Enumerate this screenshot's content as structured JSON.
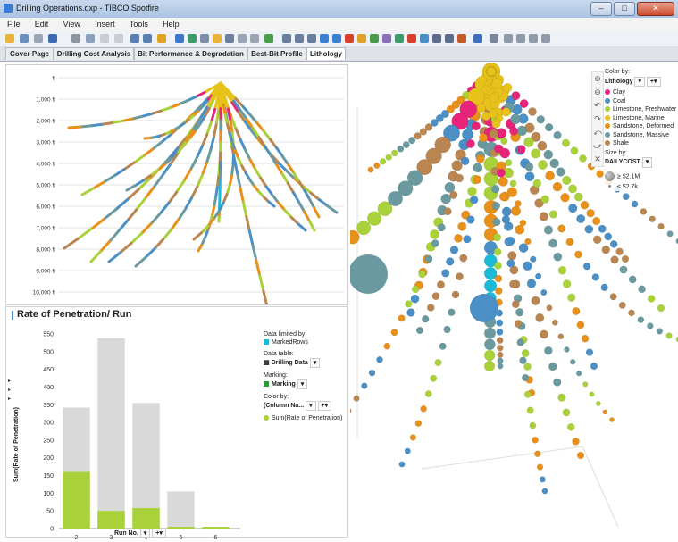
{
  "window": {
    "title": "Drilling Operations.dxp - TIBCO Spotfire",
    "minimize": "–",
    "maximize": "□",
    "close": "✕"
  },
  "menu": [
    "File",
    "Edit",
    "View",
    "Insert",
    "Tools",
    "Help"
  ],
  "tabs": [
    {
      "label": "Cover Page",
      "active": false
    },
    {
      "label": "Drilling Cost Analysis",
      "active": false
    },
    {
      "label": "Bit Performance & Degradation",
      "active": false
    },
    {
      "label": "Best-Bit Profile",
      "active": false
    },
    {
      "label": "Lithology",
      "active": true
    }
  ],
  "depth_axis": {
    "ticks": [
      "ft",
      "1,000 ft",
      "2,000 ft",
      "3,000 ft",
      "4,000 ft",
      "5,000 ft",
      "6,000 ft",
      "7,000 ft",
      "8,000 ft",
      "9,000 ft",
      "10,000 ft"
    ]
  },
  "lithology_legend": {
    "color_by_label": "Color by:",
    "color_by_value": "Lithology",
    "items": [
      {
        "label": "Clay",
        "color": "#e8247a"
      },
      {
        "label": "Coal",
        "color": "#4a8fc6"
      },
      {
        "label": "Limestone, Freshwater",
        "color": "#a9d23a"
      },
      {
        "label": "Limestone, Marine",
        "color": "#e6c21a"
      },
      {
        "label": "Sandstone, Deformed",
        "color": "#e8901a"
      },
      {
        "label": "Sandstone, Massive",
        "color": "#6a9aa0"
      },
      {
        "label": "Shale",
        "color": "#b98652"
      }
    ],
    "size_by_label": "Size by:",
    "size_by_value": "DAILYCOST",
    "size_max": "≥ $2.1M",
    "size_min": "≤ $2.7k"
  },
  "rop_chart": {
    "title": "Rate of Penetration/ Run",
    "ylabel": "Sum(Rate of Penetration)",
    "xlabel": "Run No.",
    "legend": {
      "data_limited_label": "Data limited by:",
      "marked_rows": "MarkedRows",
      "data_table_label": "Data table:",
      "data_table_value": "Drilling Data",
      "marking_label": "Marking:",
      "marking_value": "Marking",
      "color_by_label": "Color by:",
      "color_by_value": "(Column Na...",
      "series_label": "Sum(Rate of Penetration)"
    }
  },
  "chart_data": {
    "type": "bar",
    "categories": [
      "2",
      "3",
      "4",
      "5",
      "6"
    ],
    "series": [
      {
        "name": "",
        "values": [
          342,
          538,
          355,
          105,
          5
        ],
        "color": "#d9d9d9"
      },
      {
        "name": "Sum(Rate of Penetration)",
        "values": [
          160,
          50,
          58,
          5,
          5
        ],
        "color": "#a9d23a"
      }
    ],
    "ylim": [
      0,
      550
    ],
    "yticks": [
      0,
      50,
      100,
      150,
      200,
      250,
      300,
      350,
      400,
      450,
      500,
      550
    ],
    "xlabel": "Run No.",
    "ylabel": "Sum(Rate of Penetration)",
    "title": "Rate of Penetration/ Run"
  }
}
